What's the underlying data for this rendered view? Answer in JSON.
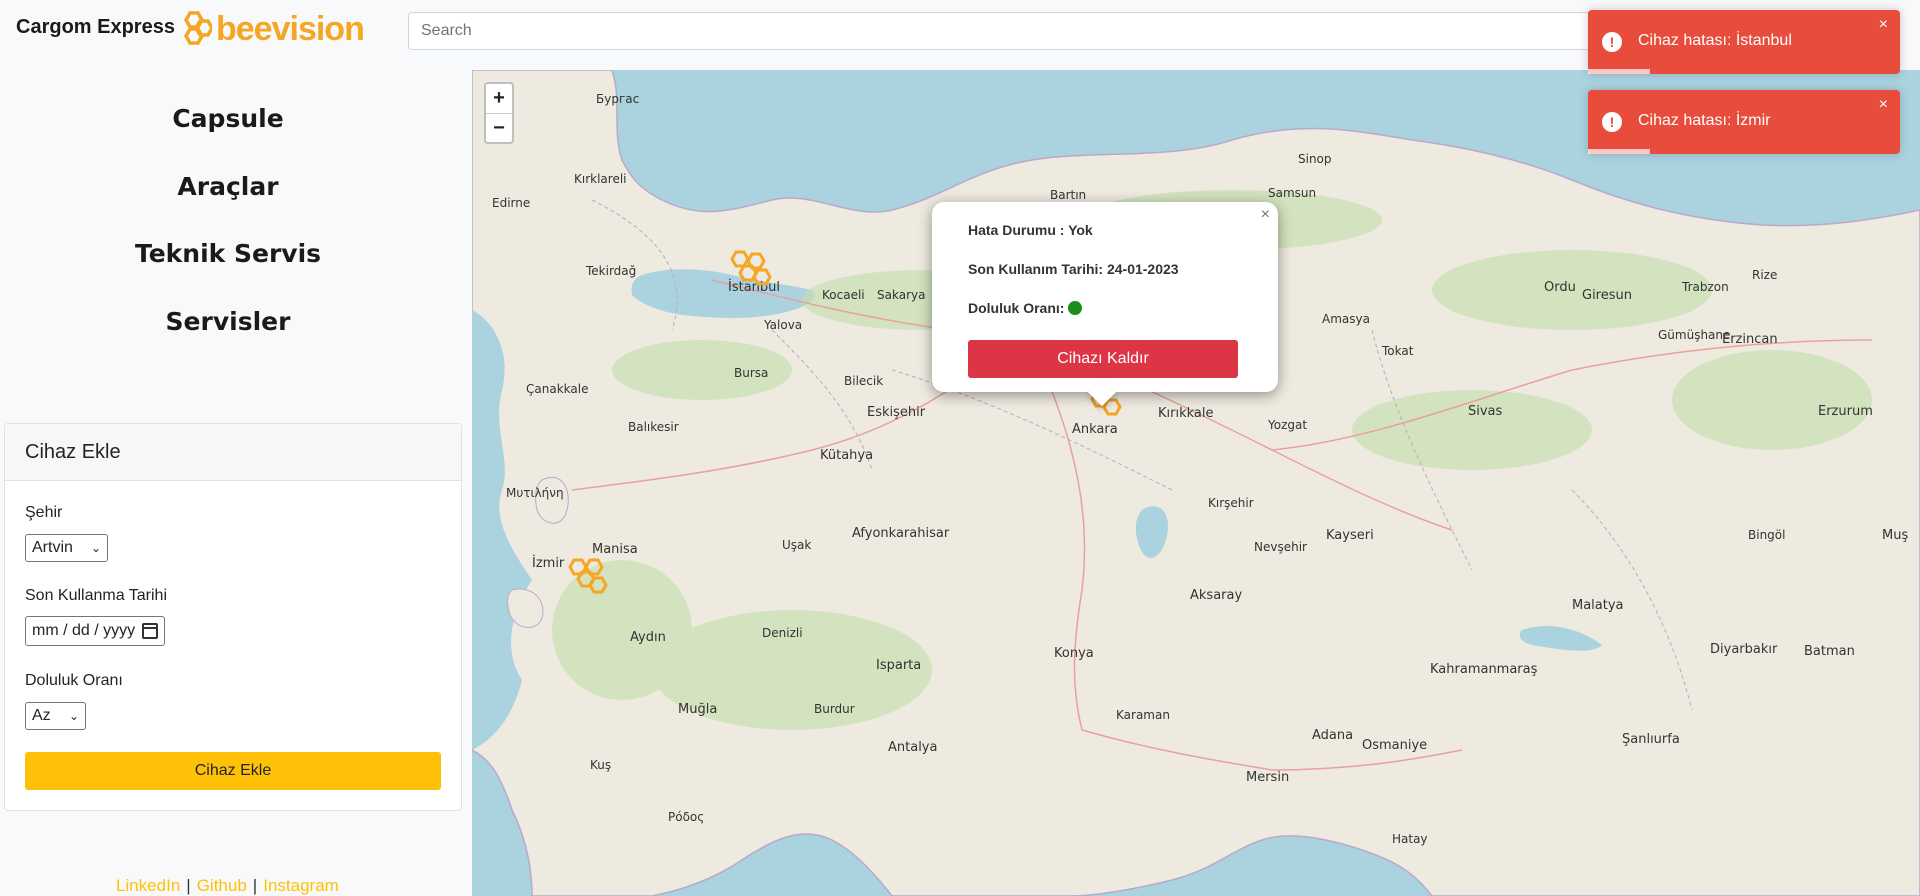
{
  "header": {
    "brand": "Cargom Express",
    "logo_text": "beevision",
    "search_placeholder": "Search"
  },
  "nav": {
    "items": [
      "Capsule",
      "Araçlar",
      "Teknik Servis",
      "Servisler"
    ]
  },
  "form": {
    "title": "Cihaz Ekle",
    "city_label": "Şehir",
    "city_value": "Artvin",
    "date_label": "Son Kullanma Tarihi",
    "date_placeholder": "mm / dd / yyyy",
    "fill_label": "Doluluk Oranı",
    "fill_value": "Az",
    "submit_label": "Cihaz Ekle"
  },
  "footer": {
    "links": [
      "LinkedIn",
      "Github",
      "Instagram"
    ]
  },
  "map": {
    "zoom_in": "+",
    "zoom_out": "−",
    "popup": {
      "error_status": "Hata Durumu : Yok",
      "last_used": "Son Kullanım Tarihi: 24-01-2023",
      "fill_label": "Doluluk Oranı:",
      "fill_color": "#1a8f1a",
      "remove_label": "Cihazı Kaldır",
      "close_label": "×"
    },
    "cities": {
      "istanbul": "İstanbul",
      "izmir": "İzmir",
      "manisa": "Manisa",
      "aydin": "Aydın",
      "mugla": "Muğla",
      "antalya": "Antalya",
      "isparta": "Isparta",
      "afyon": "Afyonkarahisar",
      "kutahya": "Kütahya",
      "eskisehir": "Eskişehir",
      "balikesir": "Balıkesir",
      "bursa": "Bursa",
      "yalova": "Yalova",
      "kocaeli": "Kocaeli",
      "ankara": "Ankara",
      "konya": "Konya",
      "karaman": "Karaman",
      "mersin": "Mersin",
      "adana": "Adana",
      "osmaniye": "Osmaniye",
      "kahramanmaras": "Kahramanmaraş",
      "aksaray": "Aksaray",
      "kirsehir": "Kırşehir",
      "nevsehir": "Nevşehir",
      "kayseri": "Kayseri",
      "yozgat": "Yozgat",
      "kirikkale": "Kırıkkale",
      "sivas": "Sivas",
      "malatya": "Malatya",
      "diyarbakir": "Diyarbakır",
      "batman": "Batman",
      "sanliurfa": "Şanlıurfa",
      "ordu": "Ordu",
      "giresun": "Giresun",
      "samsun": "Samsun",
      "sinop": "Sinop",
      "bartin": "Bartın",
      "erzincan": "Erzincan",
      "erzurum": "Erzurum",
      "bingol": "Bingöl",
      "mus": "Muş",
      "usak": "Uşak",
      "edirne": "Edirne",
      "kirklareli": "Kırklareli",
      "tekirdag": "Tekirdağ",
      "canakkale": "Çanakkale",
      "sakarya": "Sakarya",
      "bilecik": "Bilecik",
      "denizli": "Denizli",
      "burdur": "Burdur",
      "hatay": "Hatay",
      "kus": "Kuş",
      "rize": "Rize",
      "trabzon": "Trabzon",
      "gumushane": "Gümüşhane",
      "tokat": "Tokat",
      "amasya": "Amasya",
      "burgas": "Бургас",
      "mytilini": "Μυτιλήνη",
      "rodos": "Ρόδος"
    }
  },
  "toasts": [
    {
      "text": "Cihaz hatası: İstanbul",
      "close": "×"
    },
    {
      "text": "Cihaz hatası: İzmir",
      "close": "×"
    }
  ]
}
